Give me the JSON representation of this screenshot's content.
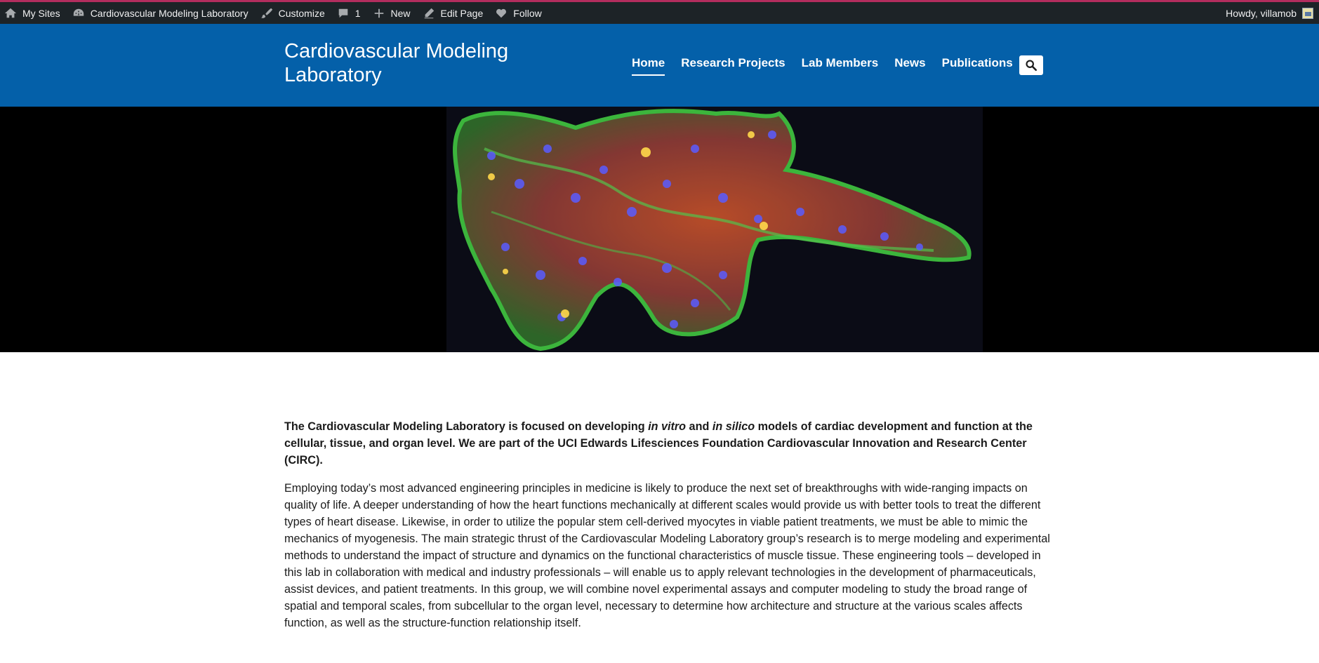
{
  "adminbar": {
    "my_sites": "My Sites",
    "site_name": "Cardiovascular Modeling Laboratory",
    "customize": "Customize",
    "comments_count": "1",
    "new": "New",
    "edit_page": "Edit Page",
    "follow": "Follow",
    "howdy": "Howdy, villamob"
  },
  "header": {
    "site_title": "Cardiovascular Modeling Laboratory",
    "nav": [
      "Home",
      "Research Projects",
      "Lab Members",
      "News",
      "Publications"
    ],
    "active_nav": "Home"
  },
  "content": {
    "intro_part1": "The Cardiovascular Modeling Laboratory is focused on developing ",
    "intro_em1": "in vitro",
    "intro_and": " and ",
    "intro_em2": "in silico",
    "intro_part2": " models of cardiac development and function at the cellular, tissue, and organ level. We are part of the UCI Edwards Lifesciences Foundation Cardiovascular Innovation and Research Center (CIRC).",
    "body": "Employing today’s most advanced engineering principles in medicine is likely to produce the next set of breakthroughs with wide-ranging impacts on quality of life. A deeper understanding of how the heart functions mechanically at different scales would provide us with better tools to treat the different types of heart disease. Likewise, in order to utilize the popular stem cell-derived myocytes in viable patient treatments, we must be able to mimic the mechanics of myogenesis. The main strategic thrust of the Cardiovascular Modeling Laboratory group’s research is to merge modeling and experimental methods to understand the impact of structure and dynamics on the functional characteristics of muscle tissue. These engineering tools – developed in this lab in collaboration with medical and industry professionals – will enable us to apply relevant technologies in the development of pharmaceuticals, assist devices, and patient treatments. In this group, we will combine novel experimental assays and computer modeling to study the broad range of spatial and temporal scales, from subcellular to the organ level, necessary to determine how architecture and structure at the various scales affects function, as well as the structure-function relationship itself."
  },
  "colors": {
    "adminbar_bg": "#1d2327",
    "adminbar_accent": "#b32d5e",
    "header_bg": "#0460a9",
    "hero_bg": "#000000"
  }
}
